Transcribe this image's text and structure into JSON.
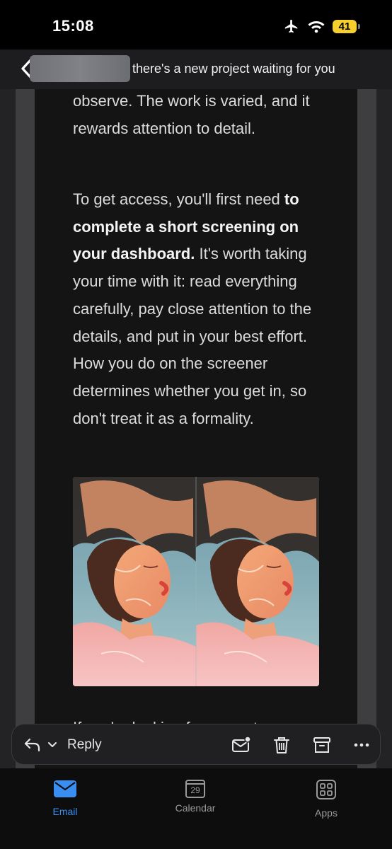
{
  "status": {
    "time": "15:08",
    "battery": "41"
  },
  "header": {
    "subject": "there's a new project waiting for you"
  },
  "body": {
    "p1": "observe. The work is varied, and it rewards attention to detail.",
    "p2_start": "To get access, you'll first need ",
    "p2_bold": "to complete a short screening on your dashboard.",
    "p2_end": " It's worth taking your time with it: read everything carefully, pay close attention to the details, and put in your best effort. How you do on the screener determines whether you get in, so don't treat it as a formality.",
    "p3": "If you're looking for a way to"
  },
  "actions": {
    "reply_label": "Reply"
  },
  "tabs": [
    {
      "label": "Email",
      "icon": "envelope-icon",
      "active": true
    },
    {
      "label": "Calendar",
      "icon": "calendar-icon",
      "day": "29",
      "active": false
    },
    {
      "label": "Apps",
      "icon": "apps-grid-icon",
      "active": false
    }
  ],
  "colors": {
    "accent": "#3a8ef2",
    "battery": "#f4cf2e",
    "background": "#141414"
  }
}
